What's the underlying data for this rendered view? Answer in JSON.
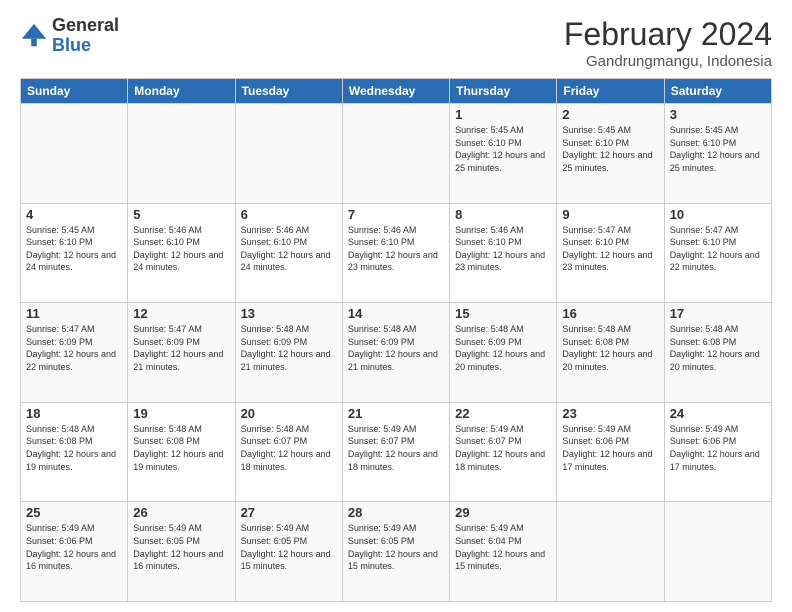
{
  "logo": {
    "general": "General",
    "blue": "Blue"
  },
  "header": {
    "month": "February 2024",
    "location": "Gandrungmangu, Indonesia"
  },
  "weekdays": [
    "Sunday",
    "Monday",
    "Tuesday",
    "Wednesday",
    "Thursday",
    "Friday",
    "Saturday"
  ],
  "weeks": [
    [
      {
        "day": "",
        "info": ""
      },
      {
        "day": "",
        "info": ""
      },
      {
        "day": "",
        "info": ""
      },
      {
        "day": "",
        "info": ""
      },
      {
        "day": "1",
        "info": "Sunrise: 5:45 AM\nSunset: 6:10 PM\nDaylight: 12 hours and 25 minutes."
      },
      {
        "day": "2",
        "info": "Sunrise: 5:45 AM\nSunset: 6:10 PM\nDaylight: 12 hours and 25 minutes."
      },
      {
        "day": "3",
        "info": "Sunrise: 5:45 AM\nSunset: 6:10 PM\nDaylight: 12 hours and 25 minutes."
      }
    ],
    [
      {
        "day": "4",
        "info": "Sunrise: 5:45 AM\nSunset: 6:10 PM\nDaylight: 12 hours and 24 minutes."
      },
      {
        "day": "5",
        "info": "Sunrise: 5:46 AM\nSunset: 6:10 PM\nDaylight: 12 hours and 24 minutes."
      },
      {
        "day": "6",
        "info": "Sunrise: 5:46 AM\nSunset: 6:10 PM\nDaylight: 12 hours and 24 minutes."
      },
      {
        "day": "7",
        "info": "Sunrise: 5:46 AM\nSunset: 6:10 PM\nDaylight: 12 hours and 23 minutes."
      },
      {
        "day": "8",
        "info": "Sunrise: 5:46 AM\nSunset: 6:10 PM\nDaylight: 12 hours and 23 minutes."
      },
      {
        "day": "9",
        "info": "Sunrise: 5:47 AM\nSunset: 6:10 PM\nDaylight: 12 hours and 23 minutes."
      },
      {
        "day": "10",
        "info": "Sunrise: 5:47 AM\nSunset: 6:10 PM\nDaylight: 12 hours and 22 minutes."
      }
    ],
    [
      {
        "day": "11",
        "info": "Sunrise: 5:47 AM\nSunset: 6:09 PM\nDaylight: 12 hours and 22 minutes."
      },
      {
        "day": "12",
        "info": "Sunrise: 5:47 AM\nSunset: 6:09 PM\nDaylight: 12 hours and 21 minutes."
      },
      {
        "day": "13",
        "info": "Sunrise: 5:48 AM\nSunset: 6:09 PM\nDaylight: 12 hours and 21 minutes."
      },
      {
        "day": "14",
        "info": "Sunrise: 5:48 AM\nSunset: 6:09 PM\nDaylight: 12 hours and 21 minutes."
      },
      {
        "day": "15",
        "info": "Sunrise: 5:48 AM\nSunset: 6:09 PM\nDaylight: 12 hours and 20 minutes."
      },
      {
        "day": "16",
        "info": "Sunrise: 5:48 AM\nSunset: 6:08 PM\nDaylight: 12 hours and 20 minutes."
      },
      {
        "day": "17",
        "info": "Sunrise: 5:48 AM\nSunset: 6:08 PM\nDaylight: 12 hours and 20 minutes."
      }
    ],
    [
      {
        "day": "18",
        "info": "Sunrise: 5:48 AM\nSunset: 6:08 PM\nDaylight: 12 hours and 19 minutes."
      },
      {
        "day": "19",
        "info": "Sunrise: 5:48 AM\nSunset: 6:08 PM\nDaylight: 12 hours and 19 minutes."
      },
      {
        "day": "20",
        "info": "Sunrise: 5:48 AM\nSunset: 6:07 PM\nDaylight: 12 hours and 18 minutes."
      },
      {
        "day": "21",
        "info": "Sunrise: 5:49 AM\nSunset: 6:07 PM\nDaylight: 12 hours and 18 minutes."
      },
      {
        "day": "22",
        "info": "Sunrise: 5:49 AM\nSunset: 6:07 PM\nDaylight: 12 hours and 18 minutes."
      },
      {
        "day": "23",
        "info": "Sunrise: 5:49 AM\nSunset: 6:06 PM\nDaylight: 12 hours and 17 minutes."
      },
      {
        "day": "24",
        "info": "Sunrise: 5:49 AM\nSunset: 6:06 PM\nDaylight: 12 hours and 17 minutes."
      }
    ],
    [
      {
        "day": "25",
        "info": "Sunrise: 5:49 AM\nSunset: 6:06 PM\nDaylight: 12 hours and 16 minutes."
      },
      {
        "day": "26",
        "info": "Sunrise: 5:49 AM\nSunset: 6:05 PM\nDaylight: 12 hours and 16 minutes."
      },
      {
        "day": "27",
        "info": "Sunrise: 5:49 AM\nSunset: 6:05 PM\nDaylight: 12 hours and 15 minutes."
      },
      {
        "day": "28",
        "info": "Sunrise: 5:49 AM\nSunset: 6:05 PM\nDaylight: 12 hours and 15 minutes."
      },
      {
        "day": "29",
        "info": "Sunrise: 5:49 AM\nSunset: 6:04 PM\nDaylight: 12 hours and 15 minutes."
      },
      {
        "day": "",
        "info": ""
      },
      {
        "day": "",
        "info": ""
      }
    ]
  ]
}
